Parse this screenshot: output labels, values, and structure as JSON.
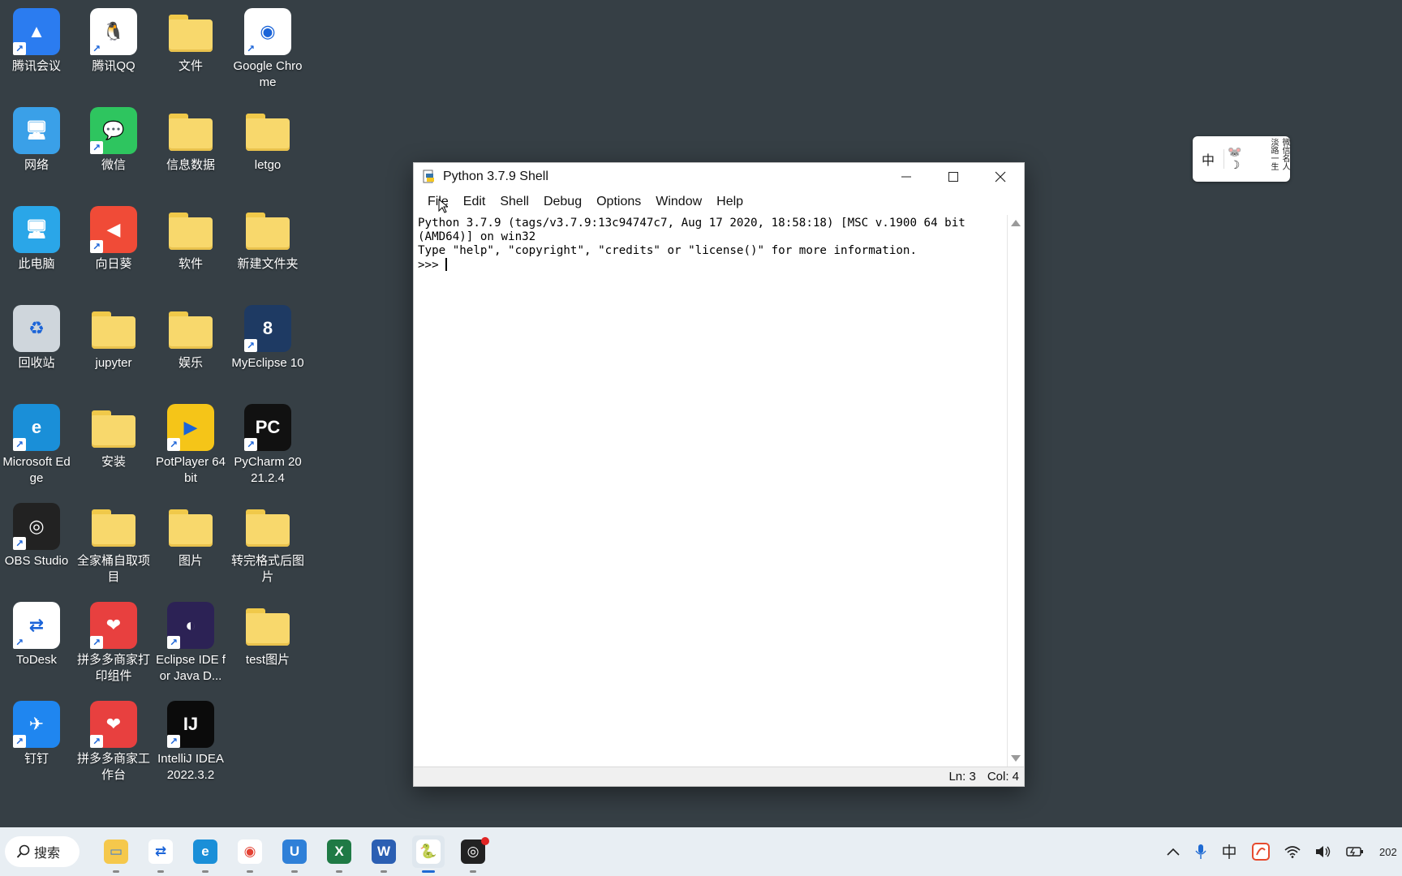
{
  "desktop": {
    "icons": [
      {
        "label": "腾讯会议",
        "color": "#2b7cf0"
      },
      {
        "label": "腾讯QQ",
        "color": "#ffffff"
      },
      {
        "label": "文件",
        "color": "folder"
      },
      {
        "label": "Google Chrome",
        "color": "#ffffff"
      },
      {
        "label": "网络",
        "color": "#3aa0e8"
      },
      {
        "label": "微信",
        "color": "#2ec55f"
      },
      {
        "label": "信息数据",
        "color": "folder"
      },
      {
        "label": "letgo",
        "color": "folder"
      },
      {
        "label": "此电脑",
        "color": "#2aa6e8"
      },
      {
        "label": "向日葵",
        "color": "#f04b37"
      },
      {
        "label": "软件",
        "color": "folder"
      },
      {
        "label": "新建文件夹",
        "color": "folder"
      },
      {
        "label": "回收站",
        "color": "#cfd6dc"
      },
      {
        "label": "jupyter",
        "color": "folder"
      },
      {
        "label": "娱乐",
        "color": "folder"
      },
      {
        "label": "MyEclipse 10",
        "color": "#1e3a63"
      },
      {
        "label": "Microsoft Edge",
        "color": "#1a8fd8"
      },
      {
        "label": "安装",
        "color": "folder"
      },
      {
        "label": "PotPlayer 64 bit",
        "color": "#f5c518"
      },
      {
        "label": "PyCharm 2021.2.4",
        "color": "#111111"
      },
      {
        "label": "OBS Studio",
        "color": "#222222"
      },
      {
        "label": "全家桶自取项目",
        "color": "folder"
      },
      {
        "label": "图片",
        "color": "folder"
      },
      {
        "label": "转完格式后图片",
        "color": "folder"
      },
      {
        "label": "ToDesk",
        "color": "#ffffff"
      },
      {
        "label": "拼多多商家打印组件",
        "color": "#e8403f"
      },
      {
        "label": "Eclipse IDE for Java D...",
        "color": "#2c2255"
      },
      {
        "label": "test图片",
        "color": "folder"
      },
      {
        "label": "钉钉",
        "color": "#1f86f0"
      },
      {
        "label": "拼多多商家工作台",
        "color": "#e8403f"
      },
      {
        "label": "IntelliJ IDEA 2022.3.2",
        "color": "#0b0b0b"
      }
    ]
  },
  "window": {
    "title": "Python 3.7.9 Shell",
    "menu": [
      "File",
      "Edit",
      "Shell",
      "Debug",
      "Options",
      "Window",
      "Help"
    ],
    "shell_lines": [
      "Python 3.7.9 (tags/v3.7.9:13c94747c7, Aug 17 2020, 18:58:18) [MSC v.1900 64 bit (AMD64)] on win32",
      "Type \"help\", \"copyright\", \"credits\" or \"license()\" for more information."
    ],
    "prompt": ">>> ",
    "status": {
      "ln": "Ln: 3",
      "col": "Col: 4"
    }
  },
  "ime": {
    "mode": "中",
    "text": "微信名人 淡路一生"
  },
  "taskbar": {
    "search_label": "搜索",
    "apps": [
      "file-explorer",
      "todesk",
      "edge",
      "chrome",
      "toolbox",
      "excel",
      "word",
      "python-idle",
      "obs"
    ],
    "clock_partial": "202"
  }
}
